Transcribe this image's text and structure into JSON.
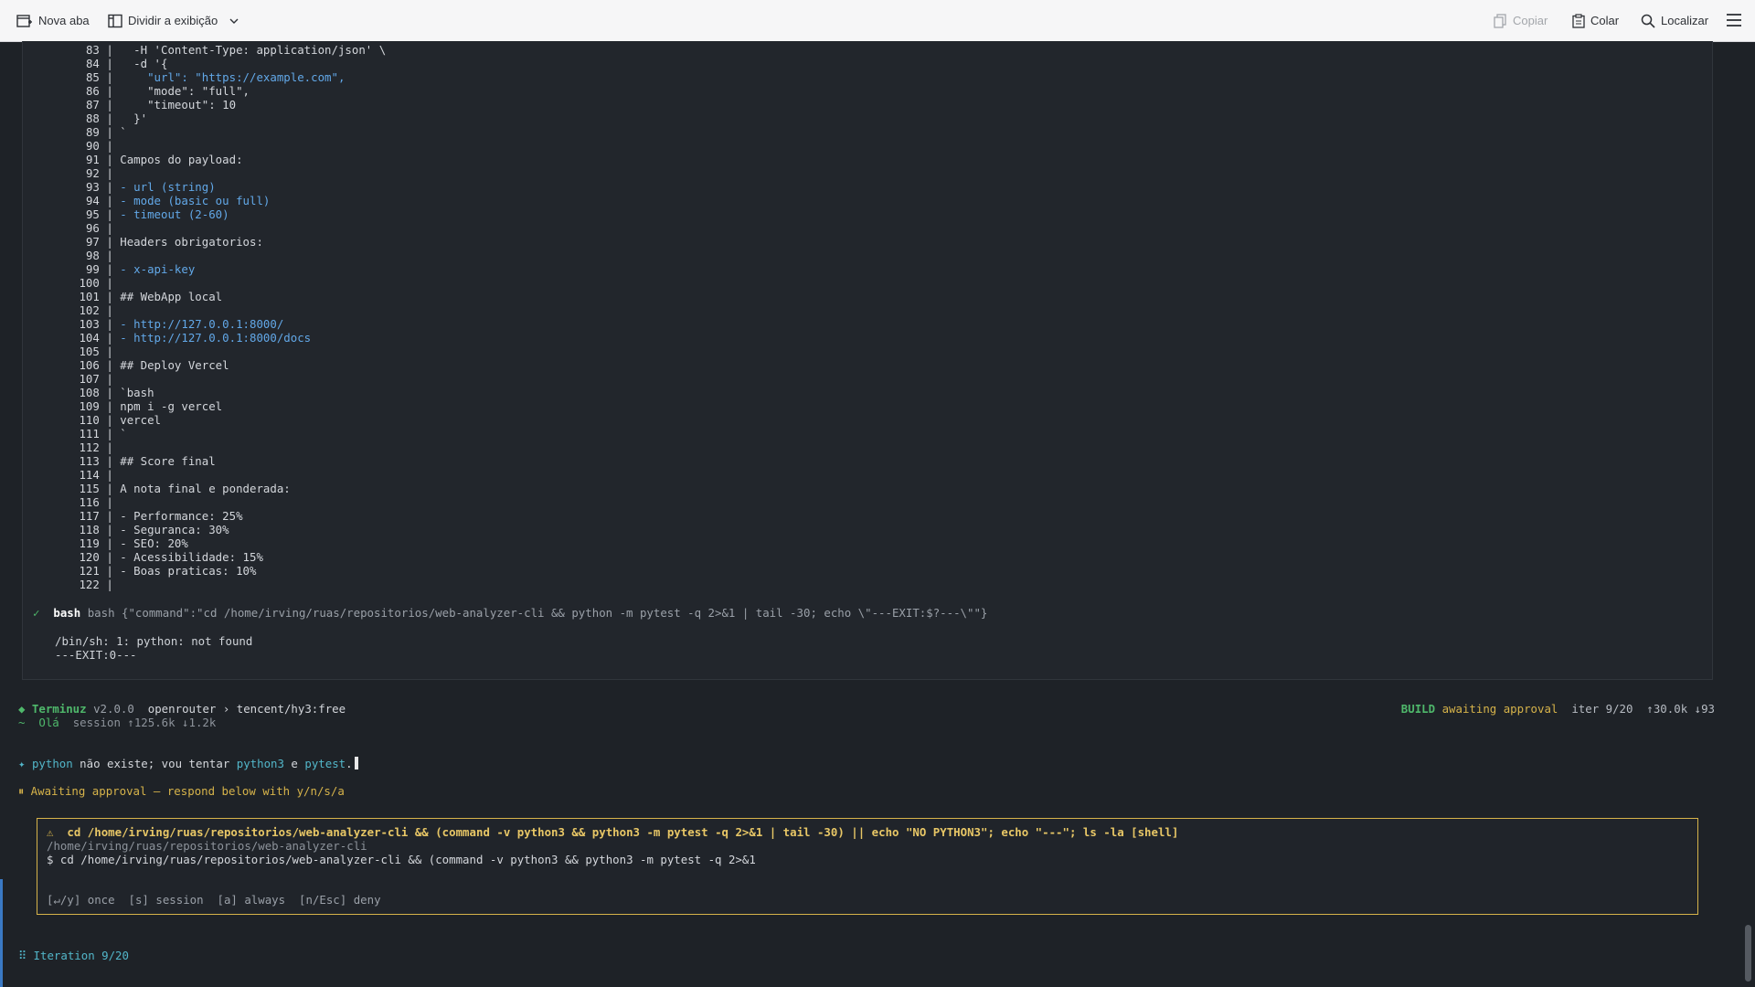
{
  "toolbar": {
    "new_tab": "Nova aba",
    "split_view": "Dividir a exibição",
    "copy": "Copiar",
    "paste": "Colar",
    "find": "Localizar"
  },
  "code_lines": [
    {
      "n": "83",
      "t": "  -H 'Content-Type: application/json' \\"
    },
    {
      "n": "84",
      "t": "  -d '{"
    },
    {
      "n": "85",
      "t": "    \"url\": \"https://example.com\","
    },
    {
      "n": "86",
      "t": "    \"mode\": \"full\","
    },
    {
      "n": "87",
      "t": "    \"timeout\": 10"
    },
    {
      "n": "88",
      "t": "  }'"
    },
    {
      "n": "89",
      "t": "`"
    },
    {
      "n": "90",
      "t": ""
    },
    {
      "n": "91",
      "t": "Campos do payload:"
    },
    {
      "n": "92",
      "t": ""
    },
    {
      "n": "93",
      "t": "- url (string)"
    },
    {
      "n": "94",
      "t": "- mode (basic ou full)"
    },
    {
      "n": "95",
      "t": "- timeout (2-60)"
    },
    {
      "n": "96",
      "t": ""
    },
    {
      "n": "97",
      "t": "Headers obrigatorios:"
    },
    {
      "n": "98",
      "t": ""
    },
    {
      "n": "99",
      "t": "- x-api-key"
    },
    {
      "n": "100",
      "t": ""
    },
    {
      "n": "101",
      "t": "## WebApp local"
    },
    {
      "n": "102",
      "t": ""
    },
    {
      "n": "103",
      "t": "- http://127.0.0.1:8000/"
    },
    {
      "n": "104",
      "t": "- http://127.0.0.1:8000/docs"
    },
    {
      "n": "105",
      "t": ""
    },
    {
      "n": "106",
      "t": "## Deploy Vercel"
    },
    {
      "n": "107",
      "t": ""
    },
    {
      "n": "108",
      "t": "`bash"
    },
    {
      "n": "109",
      "t": "npm i -g vercel"
    },
    {
      "n": "110",
      "t": "vercel"
    },
    {
      "n": "111",
      "t": "`"
    },
    {
      "n": "112",
      "t": ""
    },
    {
      "n": "113",
      "t": "## Score final"
    },
    {
      "n": "114",
      "t": ""
    },
    {
      "n": "115",
      "t": "A nota final e ponderada:"
    },
    {
      "n": "116",
      "t": ""
    },
    {
      "n": "117",
      "t": "- Performance: 25%"
    },
    {
      "n": "118",
      "t": "- Seguranca: 30%"
    },
    {
      "n": "119",
      "t": "- SEO: 20%"
    },
    {
      "n": "120",
      "t": "- Acessibilidade: 15%"
    },
    {
      "n": "121",
      "t": "- Boas praticas: 10%"
    },
    {
      "n": "122",
      "t": ""
    }
  ],
  "tool_call": {
    "check": "✓",
    "name": "bash",
    "command": "bash {\"command\":\"cd /home/irving/ruas/repositorios/web-analyzer-cli && python -m pytest -q 2>&1 | tail -30; echo \\\"---EXIT:$?---\\\"\"}",
    "output_1": "/bin/sh: 1: python: not found",
    "output_2": "---EXIT:0---"
  },
  "status": {
    "app_name": "Terminuz",
    "version": "v2.0.0",
    "provider": "openrouter › tencent/hy3:free",
    "greeting": "~  Olá",
    "session": "session ↑125.6k ↓1.2k",
    "mode": "BUILD",
    "state": "awaiting approval",
    "iter": "iter 9/20",
    "tokens": "↑30.0k ↓93"
  },
  "message": {
    "prefix": "✦",
    "w1": "python",
    "t1": " não existe; vou tentar ",
    "w2": "python3",
    "t2": " e ",
    "w3": "pytest",
    "t3": "."
  },
  "awaiting": "⏸ Awaiting approval — respond below with y/n/s/a",
  "approval": {
    "warn": "⚠",
    "command": "cd /home/irving/ruas/repositorios/web-analyzer-cli && (command -v python3 && python3 -m pytest -q 2>&1 | tail -30) || echo \"NO PYTHON3\"; echo \"---\"; ls -la [shell]",
    "cwd": "/home/irving/ruas/repositorios/web-analyzer-cli",
    "preview": "$ cd /home/irving/ruas/repositorios/web-analyzer-cli && (command -v python3 && python3 -m pytest -q 2>&1",
    "options": "[↵/y] once  [s] session  [a] always  [n/Esc] deny"
  },
  "iteration": "⠿ Iteration 9/20"
}
